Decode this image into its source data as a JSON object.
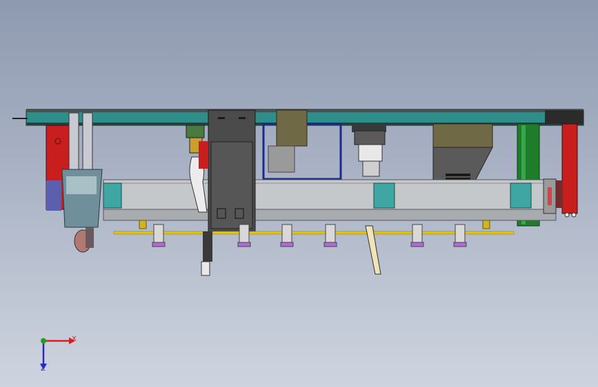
{
  "view": {
    "background_top": "#8e9ab0",
    "background_bottom": "#ced4df"
  },
  "triad": {
    "x_label": "X",
    "y_label": "Y",
    "z_label": "Z",
    "x_color": "#d81e1e",
    "y_color": "#1ea01e",
    "z_color": "#2a2acc"
  },
  "colors": {
    "teal_rail": "#2e8f8a",
    "red_column": "#c81e1e",
    "green_column": "#1d7d2a",
    "grey_beam": "#bfc3c6",
    "yellow_rod": "#e0c418",
    "olive_box": "#6f6a45",
    "dark_panel": "#4b4b4b"
  }
}
